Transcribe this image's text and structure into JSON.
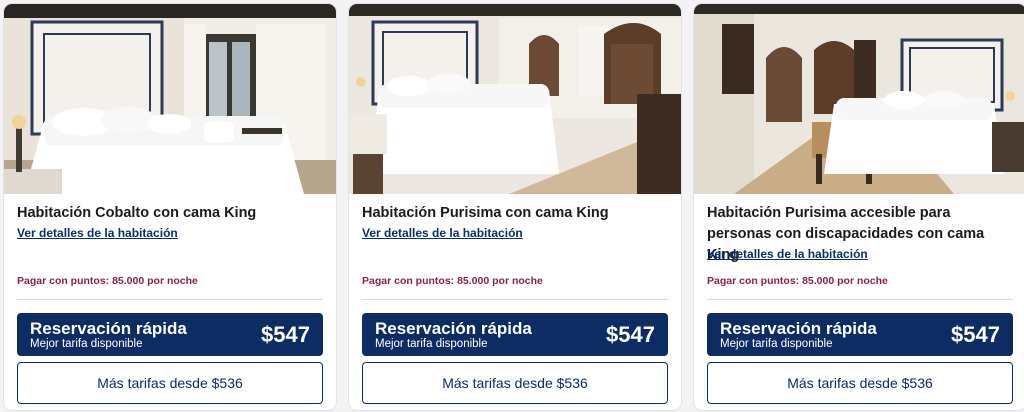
{
  "rooms": [
    {
      "title": "Habitación Cobalto con cama King",
      "details_link": "Ver detalles de la habitación",
      "points": "Pagar con puntos: 85.000 por noche",
      "quick_title": "Reservación rápida",
      "quick_sub": "Mejor tarifa disponible",
      "quick_price": "$547",
      "more_rates": "Más tarifas desde $536"
    },
    {
      "title": "Habitación Purisima con cama King",
      "details_link": "Ver detalles de la habitación",
      "points": "Pagar con puntos: 85.000 por noche",
      "quick_title": "Reservación rápida",
      "quick_sub": "Mejor tarifa disponible",
      "quick_price": "$547",
      "more_rates": "Más tarifas desde $536"
    },
    {
      "title": "Habitación Purisima accesible para personas con discapacidades con cama King",
      "details_link": "Ver detalles de la habitación",
      "points": "Pagar con puntos: 85.000 por noche",
      "quick_title": "Reservación rápida",
      "quick_sub": "Mejor tarifa disponible",
      "quick_price": "$547",
      "more_rates": "Más tarifas desde $536"
    }
  ],
  "colors": {
    "primary": "#0c2c63",
    "link": "#0a2f69",
    "points": "#8b2050"
  }
}
